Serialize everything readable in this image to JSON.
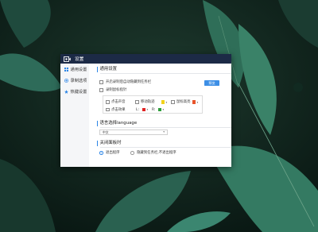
{
  "window": {
    "title": "设置"
  },
  "sidebar": {
    "items": [
      {
        "label": "通用设置",
        "icon": "grid-icon"
      },
      {
        "label": "录制选项",
        "icon": "record-icon"
      },
      {
        "label": "热键设置",
        "icon": "star-icon"
      }
    ]
  },
  "general": {
    "section_title": "通用设置",
    "hide_taskbar": {
      "label": "开启录制后自动隐藏到任务栏",
      "checked": false
    },
    "record_pointer": {
      "label": "录制鼠标指针",
      "checked": false
    },
    "preview_button": "预览",
    "effects": {
      "click_sound": {
        "label": "点击声音",
        "checked": false
      },
      "move_trail": {
        "label": "移动轨迹",
        "checked": false,
        "color": "#f2d21a"
      },
      "pointer_highlight": {
        "label": "鼠标高亮",
        "checked": false,
        "color": "#e8542b"
      },
      "click_effect": {
        "label": "点击效果",
        "checked": false
      },
      "left_label": "L:",
      "left_color": "#e02424",
      "right_label": "R:",
      "right_color": "#2e9e3a"
    }
  },
  "language": {
    "section_title": "语言选择language",
    "selected": "中文"
  },
  "close_panel": {
    "section_title": "关闭面板时",
    "options": [
      {
        "label": "退出程序",
        "selected": true
      },
      {
        "label": "隐藏到任务栏,不退出程序",
        "selected": false
      }
    ]
  },
  "colors": {
    "accent": "#2d86e6",
    "titlebar": "#1c2a46"
  }
}
